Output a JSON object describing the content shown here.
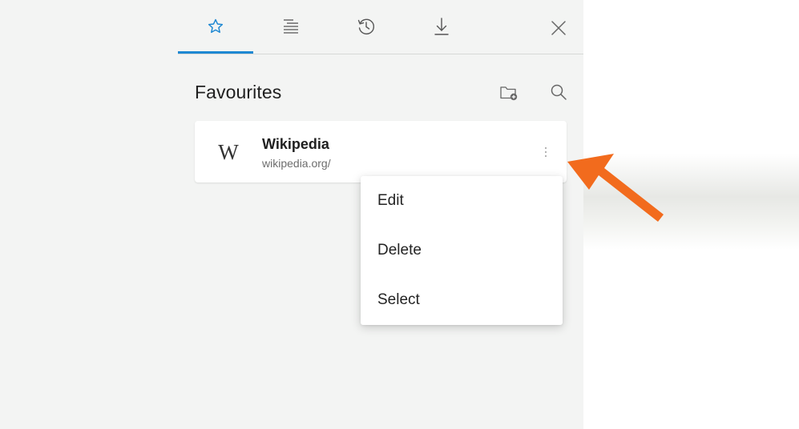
{
  "tabs": [
    {
      "name": "favourites",
      "icon": "star-icon",
      "active": true
    },
    {
      "name": "reading-list",
      "icon": "reading-list-icon",
      "active": false
    },
    {
      "name": "history",
      "icon": "history-icon",
      "active": false
    },
    {
      "name": "downloads",
      "icon": "download-icon",
      "active": false
    }
  ],
  "toolbar": {
    "close_icon": "close-icon"
  },
  "section": {
    "title": "Favourites",
    "add_folder_icon": "add-folder-icon",
    "search_icon": "search-icon"
  },
  "favourites": [
    {
      "logo": "W",
      "title": "Wikipedia",
      "url": "wikipedia.org/",
      "more_icon": "more-vertical-icon"
    }
  ],
  "context_menu": {
    "items": [
      "Edit",
      "Delete",
      "Select"
    ]
  },
  "colors": {
    "accent": "#1e88d2",
    "annotation_arrow": "#f26b1d",
    "panel_bg": "#f3f4f3"
  }
}
